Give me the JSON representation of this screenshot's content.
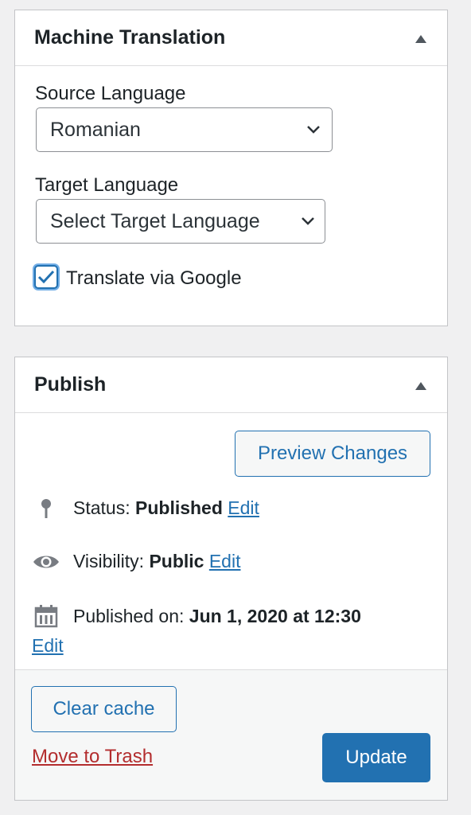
{
  "machine_translation": {
    "title": "Machine Translation",
    "source_label": "Source Language",
    "source_value": "Romanian",
    "target_label": "Target Language",
    "target_value": "Select Target Language",
    "checkbox_label": "Translate via Google",
    "checkbox_checked": true
  },
  "publish": {
    "title": "Publish",
    "preview_button": "Preview Changes",
    "status_label": "Status:",
    "status_value": "Published",
    "visibility_label": "Visibility:",
    "visibility_value": "Public",
    "published_label": "Published on:",
    "published_value": "Jun 1, 2020 at 12:30",
    "edit_link": "Edit",
    "clear_cache_button": "Clear cache",
    "trash_link": "Move to Trash",
    "update_button": "Update"
  },
  "icons": {
    "collapse": "triangle-up-icon",
    "pin": "pin-icon",
    "eye": "eye-icon",
    "calendar": "calendar-icon",
    "chevron": "chevron-down-icon",
    "check": "check-icon"
  },
  "colors": {
    "accent": "#2271b1",
    "danger": "#b32d2e",
    "background": "#f0f0f1",
    "text": "#1d2327"
  }
}
